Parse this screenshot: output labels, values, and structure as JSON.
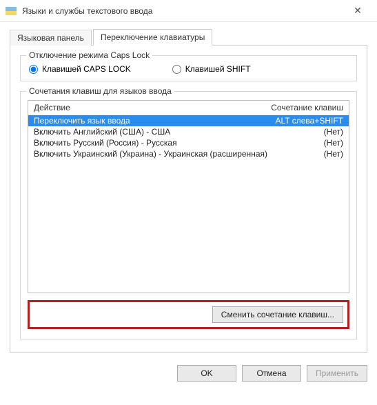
{
  "window": {
    "title": "Языки и службы текстового ввода"
  },
  "tabs": [
    {
      "label": "Языковая панель",
      "active": false
    },
    {
      "label": "Переключение клавиатуры",
      "active": true
    }
  ],
  "capslock_group": {
    "legend": "Отключение режима Caps Lock",
    "options": [
      {
        "label": "Клавишей CAPS LOCK",
        "checked": true
      },
      {
        "label": "Клавишей SHIFT",
        "checked": false
      }
    ]
  },
  "hotkeys_group": {
    "legend": "Сочетания клавиш для языков ввода",
    "headers": {
      "action": "Действие",
      "combo": "Сочетание клавиш"
    },
    "rows": [
      {
        "action": "Переключить язык ввода",
        "combo": "ALT слева+SHIFT",
        "selected": true
      },
      {
        "action": "Включить Английский (США) - США",
        "combo": "(Нет)",
        "selected": false
      },
      {
        "action": "Включить Русский (Россия) - Русская",
        "combo": "(Нет)",
        "selected": false
      },
      {
        "action": "Включить Украинский (Украина) - Украинская (расширенная)",
        "combo": "(Нет)",
        "selected": false
      }
    ],
    "change_button": "Сменить сочетание клавиш..."
  },
  "dialog_buttons": {
    "ok": "OK",
    "cancel": "Отмена",
    "apply": "Применить"
  }
}
